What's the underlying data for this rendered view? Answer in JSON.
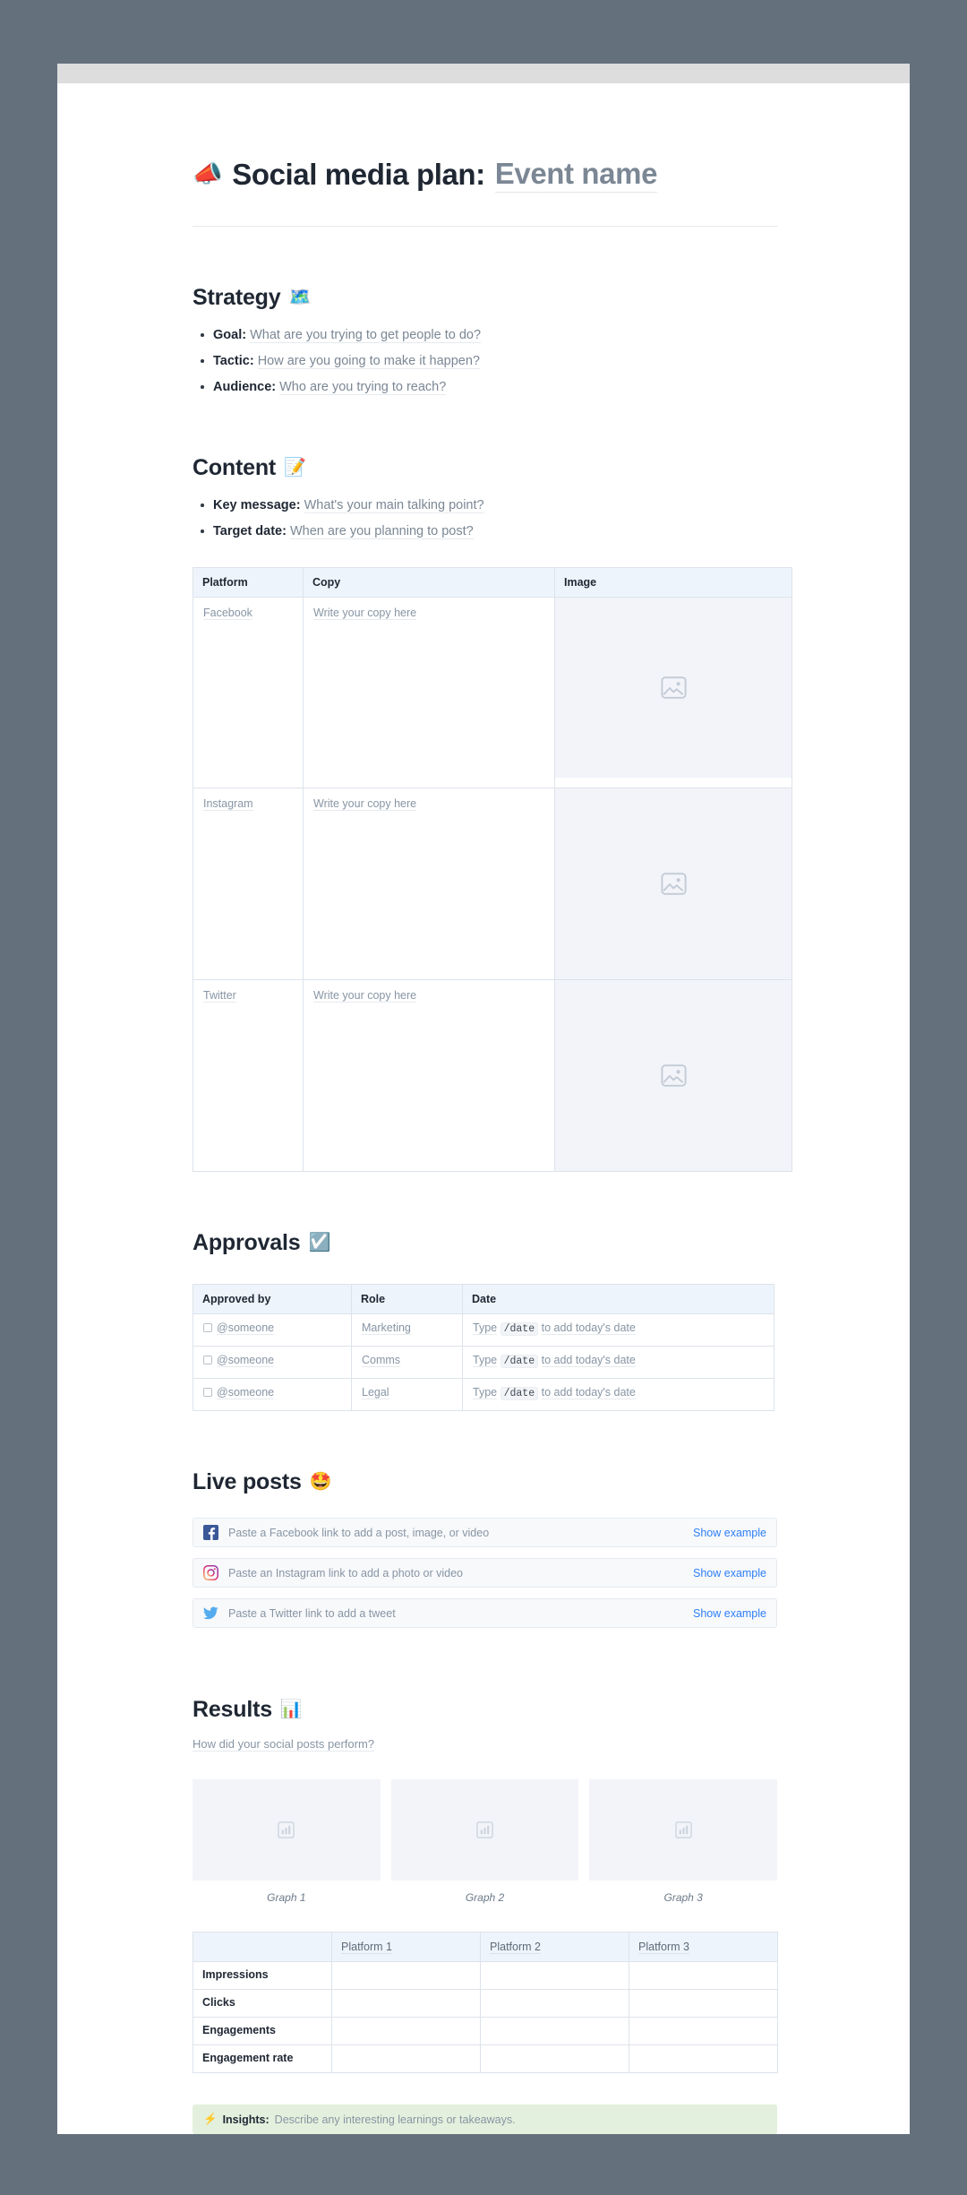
{
  "document": {
    "title_prefix": "Social media plan:",
    "title_placeholder": "Event name",
    "title_emoji": "📣"
  },
  "strategy": {
    "heading": "Strategy",
    "emoji": "🗺️",
    "items": [
      {
        "label": "Goal:",
        "placeholder": "What are you trying to get people to do?"
      },
      {
        "label": "Tactic:",
        "placeholder": "How are you going to make it happen?"
      },
      {
        "label": "Audience:",
        "placeholder": "Who are you trying to reach?"
      }
    ]
  },
  "content": {
    "heading": "Content",
    "emoji": "📝",
    "items": [
      {
        "label": "Key message:",
        "placeholder": "What's your main talking point?"
      },
      {
        "label": "Target date:",
        "placeholder": "When are you planning to post?"
      }
    ],
    "table": {
      "headers": [
        "Platform",
        "Copy",
        "Image"
      ],
      "rows": [
        {
          "platform": "Facebook",
          "copy": "Write your copy here",
          "image": "image-placeholder"
        },
        {
          "platform": "Instagram",
          "copy": "Write your copy here",
          "image": "image-placeholder"
        },
        {
          "platform": "Twitter",
          "copy": "Write your copy here",
          "image": "image-placeholder"
        }
      ]
    }
  },
  "approvals": {
    "heading": "Approvals",
    "emoji": "☑️",
    "table": {
      "headers": [
        "Approved by",
        "Role",
        "Date"
      ],
      "rows": [
        {
          "approver": "@someone",
          "role": "Marketing",
          "date_prefix": "Type",
          "date_command": "/date",
          "date_suffix": "to add today's date"
        },
        {
          "approver": "@someone",
          "role": "Comms",
          "date_prefix": "Type",
          "date_command": "/date",
          "date_suffix": "to add today's date"
        },
        {
          "approver": "@someone",
          "role": "Legal",
          "date_prefix": "Type",
          "date_command": "/date",
          "date_suffix": "to add today's date"
        }
      ]
    }
  },
  "live_posts": {
    "heading": "Live posts",
    "emoji": "🤩",
    "rows": [
      {
        "network": "facebook",
        "text": "Paste a Facebook link to add a post, image, or video",
        "action": "Show example"
      },
      {
        "network": "instagram",
        "text": "Paste an Instagram link to add a photo or video",
        "action": "Show example"
      },
      {
        "network": "twitter",
        "text": "Paste a Twitter link to add a tweet",
        "action": "Show example"
      }
    ]
  },
  "results": {
    "heading": "Results",
    "emoji": "📊",
    "subtitle": "How did your social posts perform?",
    "graphs": [
      {
        "caption": "Graph 1"
      },
      {
        "caption": "Graph 2"
      },
      {
        "caption": "Graph 3"
      }
    ],
    "table": {
      "corner": "",
      "headers": [
        "Platform 1",
        "Platform 2",
        "Platform 3"
      ],
      "rows": [
        {
          "metric": "Impressions",
          "values": [
            "",
            "",
            ""
          ]
        },
        {
          "metric": "Clicks",
          "values": [
            "",
            "",
            ""
          ]
        },
        {
          "metric": "Engagements",
          "values": [
            "",
            "",
            ""
          ]
        },
        {
          "metric": "Engagement rate",
          "values": [
            "",
            "",
            ""
          ]
        }
      ]
    }
  },
  "insights": {
    "emoji": "⚡",
    "label": "Insights:",
    "placeholder": "Describe any interesting learnings or takeaways."
  },
  "colors": {
    "accent_link": "#2d7ff9",
    "table_header_bg": "#eef4fb",
    "insight_bg": "#e3f0dd",
    "placeholder_text": "#8795a4",
    "page_bg": "#65707d"
  }
}
